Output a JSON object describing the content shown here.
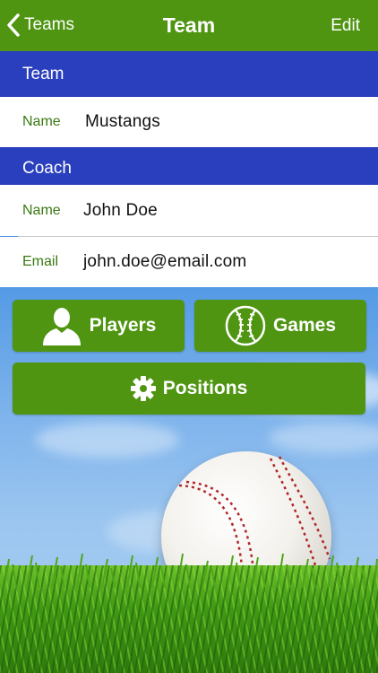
{
  "nav": {
    "back_label": "Teams",
    "title": "Team",
    "edit_label": "Edit"
  },
  "team_section": {
    "header": "Team",
    "rows": [
      {
        "label": "Name",
        "value": "Mustangs"
      }
    ]
  },
  "coach_section": {
    "header": "Coach",
    "rows": [
      {
        "label": "Name",
        "value": "John Doe"
      },
      {
        "label": "Email",
        "value": "john.doe@email.com"
      }
    ]
  },
  "buttons": {
    "players": {
      "label": "Players",
      "icon": "person-icon"
    },
    "games": {
      "label": "Games",
      "icon": "baseball-icon"
    },
    "positions": {
      "label": "Positions",
      "icon": "gear-icon"
    }
  },
  "colors": {
    "nav_green": "#4f9512",
    "header_blue": "#2a3fbd",
    "label_green": "#3a7a12"
  }
}
